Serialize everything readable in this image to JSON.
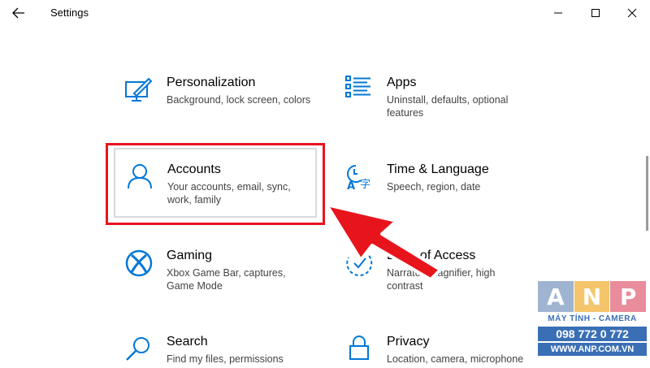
{
  "window": {
    "title": "Settings"
  },
  "tiles": {
    "personalization": {
      "name": "Personalization",
      "desc": "Background, lock screen, colors"
    },
    "apps": {
      "name": "Apps",
      "desc": "Uninstall, defaults, optional features"
    },
    "accounts": {
      "name": "Accounts",
      "desc": "Your accounts, email, sync, work, family"
    },
    "time_language": {
      "name": "Time & Language",
      "desc": "Speech, region, date"
    },
    "gaming": {
      "name": "Gaming",
      "desc": "Xbox Game Bar, captures, Game Mode"
    },
    "ease_of_access": {
      "name": "Ease of Access",
      "desc": "Narrator, magnifier, high contrast"
    },
    "search": {
      "name": "Search",
      "desc": "Find my files, permissions"
    },
    "privacy": {
      "name": "Privacy",
      "desc": "Location, camera, microphone"
    }
  },
  "annotation": {
    "highlight_color": "#e8141c"
  },
  "watermark": {
    "letters": [
      "A",
      "N",
      "P"
    ],
    "subtitle": "MÁY TÍNH - CAMERA",
    "phone": "098 772 0 772",
    "url": "WWW.ANP.COM.VN"
  },
  "colors": {
    "accent": "#0078d7",
    "text": "#000000",
    "secondary_text": "#444444"
  }
}
